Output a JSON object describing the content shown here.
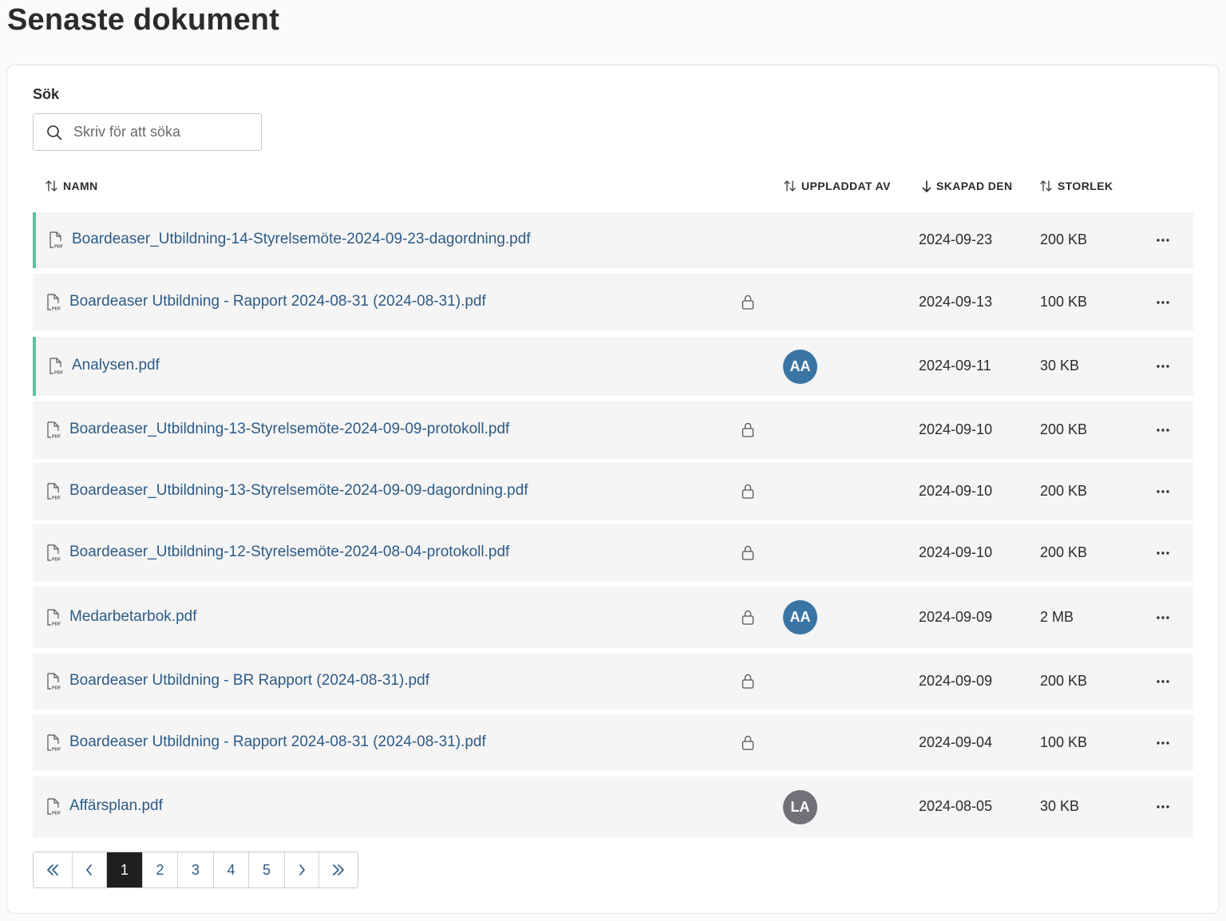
{
  "page": {
    "title": "Senaste dokument"
  },
  "search": {
    "label": "Sök",
    "placeholder": "Skriv för att söka"
  },
  "columns": {
    "name": "NAMN",
    "uploaded_by": "UPPLADDAT AV",
    "created": "SKAPAD DEN",
    "size": "STORLEK"
  },
  "sort": {
    "active_column": "created",
    "direction": "descending"
  },
  "colors": {
    "link": "#2d5b86",
    "accent_bar": "#5fbf9f",
    "avatar_blue": "#3a74a3",
    "avatar_grey": "#717078"
  },
  "documents": [
    {
      "name": "Boardeaser_Utbildning-14-Styrelsemöte-2024-09-23-dagordning.pdf",
      "locked": false,
      "uploader": "",
      "created": "2024-09-23",
      "size": "200 KB",
      "highlighted": true
    },
    {
      "name": "Boardeaser Utbildning - Rapport 2024-08-31 (2024-08-31).pdf",
      "locked": true,
      "uploader": "",
      "created": "2024-09-13",
      "size": "100 KB",
      "highlighted": false
    },
    {
      "name": "Analysen.pdf",
      "locked": false,
      "uploader": "AA",
      "uploader_color": "#3a74a3",
      "created": "2024-09-11",
      "size": "30 KB",
      "highlighted": true
    },
    {
      "name": "Boardeaser_Utbildning-13-Styrelsemöte-2024-09-09-protokoll.pdf",
      "locked": true,
      "uploader": "",
      "created": "2024-09-10",
      "size": "200 KB",
      "highlighted": false
    },
    {
      "name": "Boardeaser_Utbildning-13-Styrelsemöte-2024-09-09-dagordning.pdf",
      "locked": true,
      "uploader": "",
      "created": "2024-09-10",
      "size": "200 KB",
      "highlighted": false
    },
    {
      "name": "Boardeaser_Utbildning-12-Styrelsemöte-2024-08-04-protokoll.pdf",
      "locked": true,
      "uploader": "",
      "created": "2024-09-10",
      "size": "200 KB",
      "highlighted": false
    },
    {
      "name": "Medarbetarbok.pdf",
      "locked": true,
      "uploader": "AA",
      "uploader_color": "#3a74a3",
      "created": "2024-09-09",
      "size": "2 MB",
      "highlighted": false
    },
    {
      "name": "Boardeaser Utbildning - BR Rapport (2024-08-31).pdf",
      "locked": true,
      "uploader": "",
      "created": "2024-09-09",
      "size": "200 KB",
      "highlighted": false
    },
    {
      "name": "Boardeaser Utbildning - Rapport 2024-08-31 (2024-08-31).pdf",
      "locked": true,
      "uploader": "",
      "created": "2024-09-04",
      "size": "100 KB",
      "highlighted": false
    },
    {
      "name": "Affärsplan.pdf",
      "locked": false,
      "uploader": "LA",
      "uploader_color": "#717078",
      "created": "2024-08-05",
      "size": "30 KB",
      "highlighted": false
    }
  ],
  "pagination": {
    "pages": [
      "1",
      "2",
      "3",
      "4",
      "5"
    ],
    "current": "1",
    "first_icon": "double-chevron-left-icon",
    "prev_icon": "chevron-left-icon",
    "next_icon": "chevron-right-icon",
    "last_icon": "double-chevron-right-icon"
  }
}
